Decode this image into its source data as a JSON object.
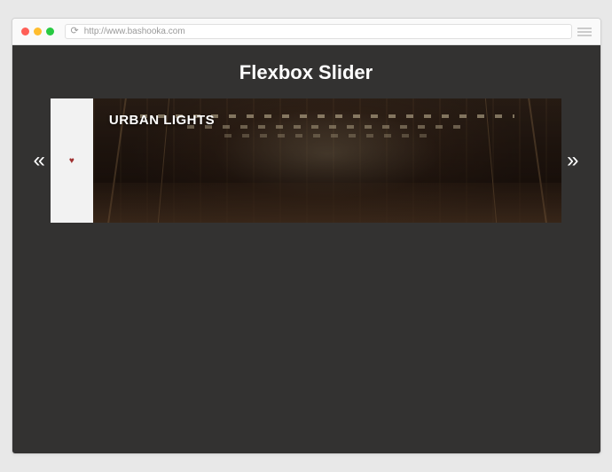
{
  "browser": {
    "url": "http://www.bashooka.com"
  },
  "page": {
    "title": "Flexbox Slider"
  },
  "slider": {
    "prev_symbol": "«",
    "next_symbol": "»",
    "heart_symbol": "♥",
    "active_slide": {
      "title": "URBAN LIGHTS"
    }
  }
}
